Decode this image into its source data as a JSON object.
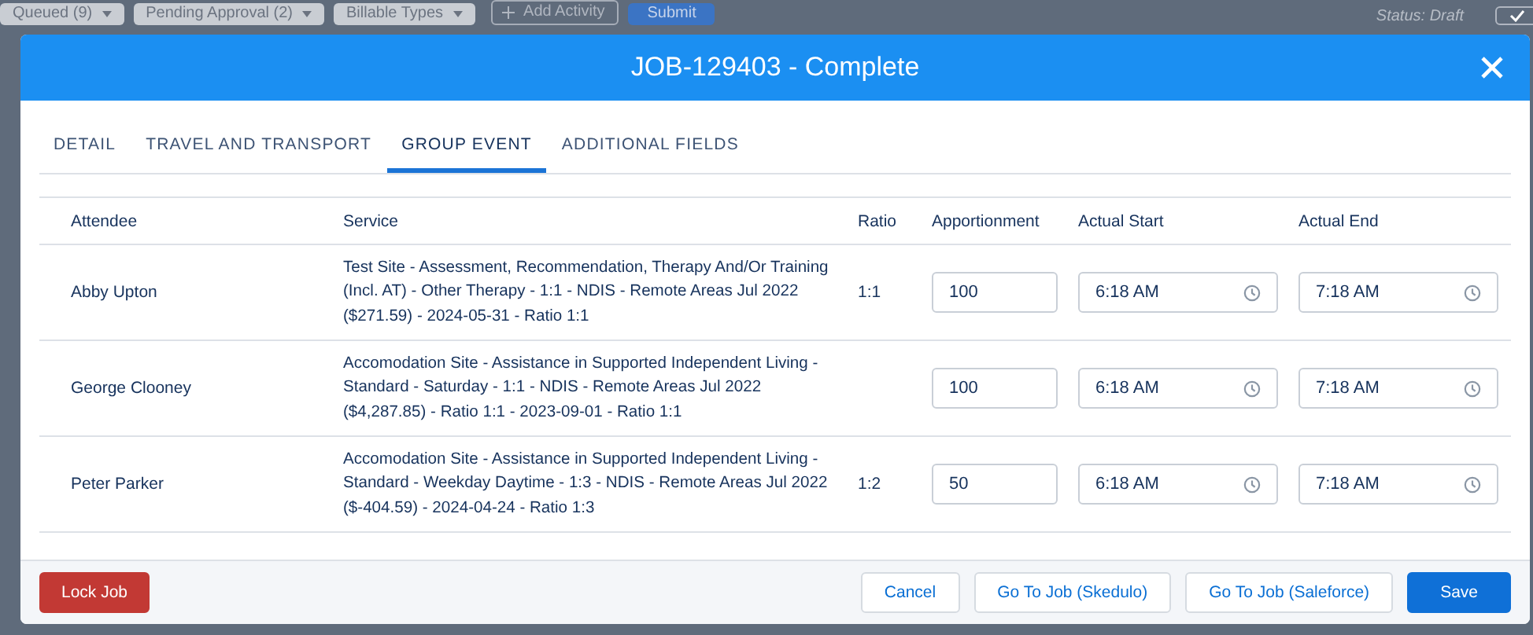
{
  "background_toolbar": {
    "filters": [
      "Queued (9)",
      "Pending Approval (2)",
      "Billable Types"
    ],
    "add_button": "Add Activity",
    "submit_button": "Submit",
    "status": "Status: Draft"
  },
  "modal": {
    "title": "JOB-129403 - Complete",
    "tabs": [
      {
        "label": "DETAIL",
        "selected": false
      },
      {
        "label": "TRAVEL AND TRANSPORT",
        "selected": false
      },
      {
        "label": "GROUP EVENT",
        "selected": true
      },
      {
        "label": "ADDITIONAL FIELDS",
        "selected": false
      }
    ],
    "table": {
      "columns": [
        "Attendee",
        "Service",
        "Ratio",
        "Apportionment",
        "Actual Start",
        "Actual End"
      ],
      "rows": [
        {
          "attendee": "Abby Upton",
          "service": "Test Site - Assessment, Recommendation, Therapy And/Or Training (Incl. AT) - Other Therapy - 1:1 - NDIS - Remote Areas Jul 2022 ($271.59) - 2024-05-31 - Ratio 1:1",
          "ratio": "1:1",
          "apportionment": "100",
          "actual_start": "6:18 AM",
          "actual_end": "7:18 AM"
        },
        {
          "attendee": "George Clooney",
          "service": "Accomodation Site - Assistance in Supported Independent Living - Standard - Saturday - 1:1 - NDIS - Remote Areas Jul 2022 ($4,287.85) - Ratio 1:1 - 2023-09-01 - Ratio 1:1",
          "apportionment": "100",
          "actual_start": "6:18 AM",
          "actual_end": "7:18 AM"
        },
        {
          "attendee": "Peter Parker",
          "service": "Accomodation Site - Assistance in Supported Independent Living - Standard - Weekday Daytime - 1:3 - NDIS - Remote Areas Jul 2022 ($-404.59) - 2024-04-24 - Ratio 1:3",
          "ratio": "1:2",
          "apportionment": "50",
          "actual_start": "6:18 AM",
          "actual_end": "7:18 AM"
        }
      ]
    },
    "footer": {
      "lock_button": "Lock Job",
      "cancel_button": "Cancel",
      "skedulo_button": "Go To Job (Skedulo)",
      "salesforce_button": "Go To Job (Saleforce)",
      "save_button": "Save"
    }
  }
}
